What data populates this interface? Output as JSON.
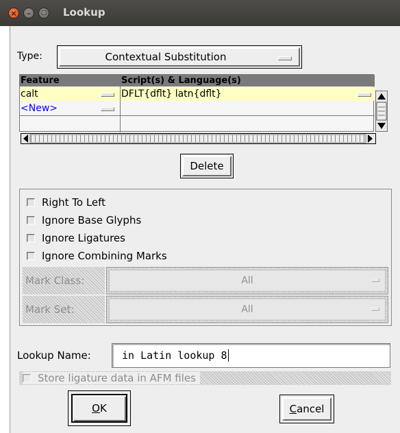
{
  "window": {
    "title": "Lookup",
    "close_glyph": "×",
    "min_glyph": "–",
    "max_glyph": "▢"
  },
  "type_row": {
    "label": "Type:",
    "value": "Contextual Substitution"
  },
  "features_table": {
    "columns": [
      "Feature",
      "Script(s) & Language(s)"
    ],
    "rows": [
      {
        "feature": "calt",
        "scripts": "DFLT{dflt} latn{dflt}"
      },
      {
        "feature": "<New>",
        "scripts": ""
      }
    ]
  },
  "delete_button": "Delete",
  "flags": [
    {
      "label": "Right To Left",
      "checked": false
    },
    {
      "label": "Ignore Base Glyphs",
      "checked": false
    },
    {
      "label": "Ignore Ligatures",
      "checked": false
    },
    {
      "label": "Ignore Combining Marks",
      "checked": false
    }
  ],
  "mark_class": {
    "label": "Mark Class:",
    "value": "All"
  },
  "mark_set": {
    "label": "Mark Set:",
    "value": "All"
  },
  "lookup_name": {
    "label": "Lookup Name:",
    "value": "in Latin lookup 8"
  },
  "afm": {
    "label": "Store ligature data in AFM files",
    "checked": false
  },
  "ok_button": {
    "label": "OK",
    "mnemonic": "O",
    "rest": "K"
  },
  "cancel_button": {
    "label": "Cancel",
    "mnemonic": "C",
    "rest": "ancel"
  },
  "colors": {
    "titlebar": "#3c3b37",
    "close_button": "#e95420",
    "selected_row": "#ffffc4",
    "new_row_text": "#0000ff",
    "disabled_text": "#8e8e8e"
  }
}
